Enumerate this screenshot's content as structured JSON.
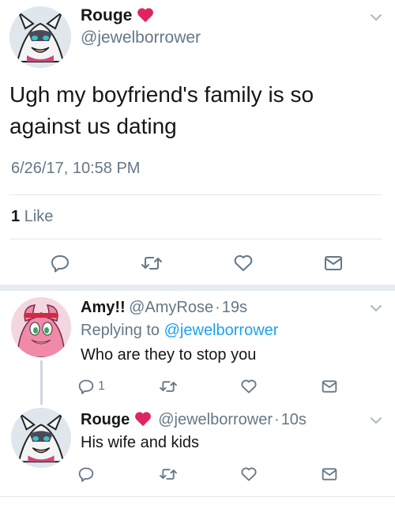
{
  "main_tweet": {
    "name": "Rouge",
    "handle": "@jewelborrower",
    "text_line1": "Ugh my boyfriend's family is so",
    "text_line2": "against us dating",
    "timestamp": "6/26/17, 10:58 PM",
    "likes_count": "1",
    "likes_label": "Like"
  },
  "replies": [
    {
      "name": "Amy!!",
      "handle": "@AmyRose",
      "sep": "·",
      "time": "19s",
      "replying_prefix": "Replying to",
      "replying_handle": "@jewelborrower",
      "text": "Who are they to stop you",
      "reply_count": "1"
    },
    {
      "name": "Rouge",
      "handle": "@jewelborrower",
      "sep": "·",
      "time": "10s",
      "text": "His wife and kids"
    }
  ],
  "icons": {
    "reply": "reply-icon",
    "retweet": "retweet-icon",
    "like": "heart-icon",
    "message": "message-icon",
    "more": "chevron-down-icon"
  },
  "colors": {
    "heart_red": "#e0245e",
    "link_blue": "#1da1f2",
    "secondary_text": "#657786",
    "icon_gray": "#657786"
  }
}
